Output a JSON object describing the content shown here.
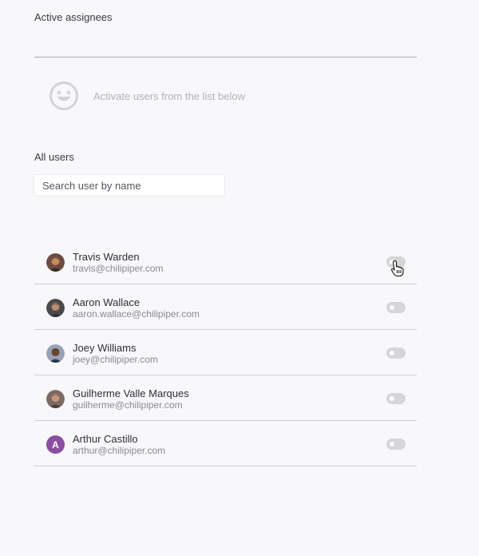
{
  "active": {
    "title": "Active assignees",
    "empty_icon": "smiley-face-icon",
    "empty_text": "Activate users from the list below"
  },
  "all_users": {
    "title": "All users",
    "search_placeholder": "Search user by name",
    "search_value": ""
  },
  "users": [
    {
      "name": "Travis Warden",
      "email": "travis@chilipiper.com",
      "active": false
    },
    {
      "name": "Aaron Wallace",
      "email": "aaron.wallace@chilipiper.com",
      "active": false
    },
    {
      "name": "Joey Williams",
      "email": "joey@chilipiper.com",
      "active": false
    },
    {
      "name": "Guilherme Valle Marques",
      "email": "guilherme@chilipiper.com",
      "active": false
    },
    {
      "name": "Arthur Castillo",
      "email": "arthur@chilipiper.com",
      "active": false,
      "avatar_initial": "A",
      "avatar_color": "#8b4ea0"
    }
  ],
  "colors": {
    "background": "#f8f7f9",
    "divider": "#cfcfd3",
    "toggle_off": "#d6d6d9"
  }
}
